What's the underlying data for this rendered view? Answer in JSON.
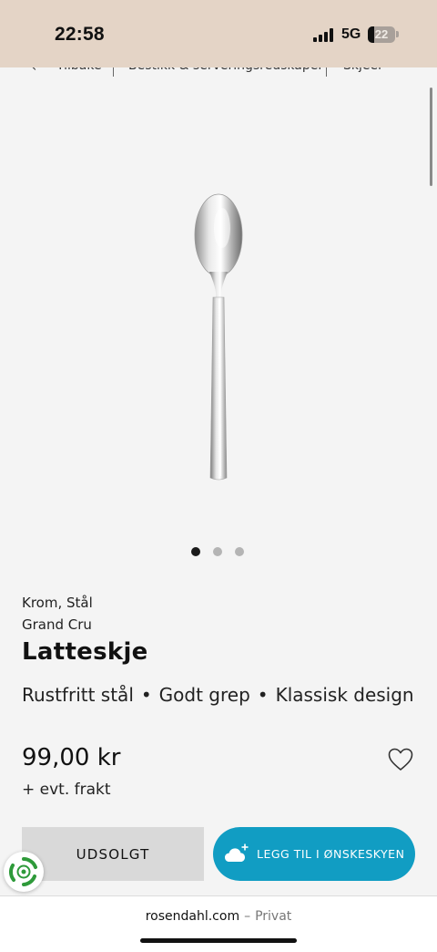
{
  "status_bar": {
    "time": "22:58",
    "network": "5G",
    "battery": "22",
    "battery_level": 0.22
  },
  "breadcrumb": {
    "back_label": "Tilbake",
    "items": [
      "Bestikk & serveringsredskaper",
      "Skjeer"
    ]
  },
  "gallery": {
    "total_images": 3,
    "active_index": 0
  },
  "product": {
    "material": "Krom, Stål",
    "collection": "Grand Cru",
    "title": "Latteskje",
    "features": [
      "Rustfritt stål",
      "Godt grep",
      "Klassisk design"
    ],
    "feature_separator": "•",
    "price": "99,00 kr",
    "shipping_note": "+ evt. frakt"
  },
  "actions": {
    "soldout_label": "UDSOLGT",
    "wishlist_label": "LEGG TIL I ØNSKESKYEN"
  },
  "browser": {
    "domain": "rosendahl.com",
    "separator": "–",
    "mode": "Privat"
  },
  "colors": {
    "status_bar_bg": "#e4d4c6",
    "page_bg": "#f4f4f4",
    "accent": "#119dc3",
    "soldout_bg": "#d9d9d9",
    "eco_green": "#2e9a3a"
  },
  "icons": {
    "back": "chevron-left-icon",
    "favorite": "heart-outline-icon",
    "wishlist": "cloud-plus-icon",
    "eco": "recycle-badge-icon"
  }
}
